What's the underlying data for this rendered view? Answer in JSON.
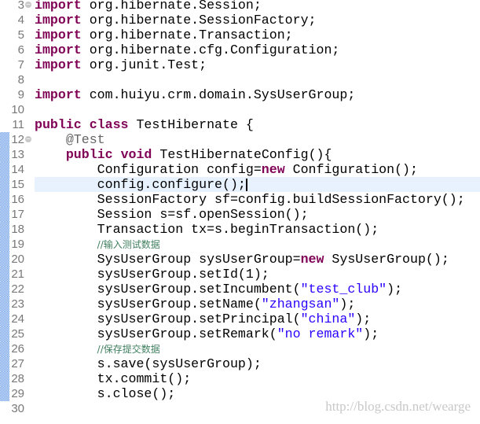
{
  "editor": {
    "lines": [
      {
        "n": "3",
        "fold": true,
        "changed": false,
        "segs": [
          [
            "k",
            "import"
          ],
          [
            "t",
            " org.hibernate.Session;"
          ]
        ]
      },
      {
        "n": "4",
        "segs": [
          [
            "k",
            "import"
          ],
          [
            "t",
            " org.hibernate.SessionFactory;"
          ]
        ]
      },
      {
        "n": "5",
        "segs": [
          [
            "k",
            "import"
          ],
          [
            "t",
            " org.hibernate.Transaction;"
          ]
        ]
      },
      {
        "n": "6",
        "segs": [
          [
            "k",
            "import"
          ],
          [
            "t",
            " org.hibernate.cfg.Configuration;"
          ]
        ]
      },
      {
        "n": "7",
        "segs": [
          [
            "k",
            "import"
          ],
          [
            "t",
            " org.junit.Test;"
          ]
        ]
      },
      {
        "n": "8",
        "segs": []
      },
      {
        "n": "9",
        "segs": [
          [
            "k",
            "import"
          ],
          [
            "t",
            " com.huiyu.crm.domain.SysUserGroup;"
          ]
        ]
      },
      {
        "n": "10",
        "segs": []
      },
      {
        "n": "11",
        "segs": [
          [
            "k",
            "public"
          ],
          [
            "t",
            " "
          ],
          [
            "k",
            "class"
          ],
          [
            "t",
            " TestHibernate {"
          ]
        ]
      },
      {
        "n": "12",
        "fold": true,
        "changed": true,
        "segs": [
          [
            "t",
            "    "
          ],
          [
            "a",
            "@Test"
          ]
        ]
      },
      {
        "n": "13",
        "changed": true,
        "segs": [
          [
            "t",
            "    "
          ],
          [
            "k",
            "public"
          ],
          [
            "t",
            " "
          ],
          [
            "k",
            "void"
          ],
          [
            "t",
            " TestHibernateConfig(){"
          ]
        ]
      },
      {
        "n": "14",
        "changed": true,
        "segs": [
          [
            "t",
            "        Configuration config="
          ],
          [
            "k",
            "new"
          ],
          [
            "t",
            " Configuration();"
          ]
        ]
      },
      {
        "n": "15",
        "changed": true,
        "current": true,
        "segs": [
          [
            "t",
            "        config.configure();"
          ]
        ]
      },
      {
        "n": "16",
        "changed": true,
        "segs": [
          [
            "t",
            "        SessionFactory sf=config.buildSessionFactory();"
          ]
        ]
      },
      {
        "n": "17",
        "changed": true,
        "segs": [
          [
            "t",
            "        Session s=sf.openSession();"
          ]
        ]
      },
      {
        "n": "18",
        "changed": true,
        "segs": [
          [
            "t",
            "        Transaction tx=s.beginTransaction();"
          ]
        ]
      },
      {
        "n": "19",
        "changed": true,
        "segs": [
          [
            "t",
            "        "
          ],
          [
            "c",
            "//输入测试数据"
          ]
        ]
      },
      {
        "n": "20",
        "changed": true,
        "segs": [
          [
            "t",
            "        SysUserGroup sysUserGroup="
          ],
          [
            "k",
            "new"
          ],
          [
            "t",
            " SysUserGroup();"
          ]
        ]
      },
      {
        "n": "21",
        "changed": true,
        "segs": [
          [
            "t",
            "        sysUserGroup.setId(1);"
          ]
        ]
      },
      {
        "n": "22",
        "changed": true,
        "segs": [
          [
            "t",
            "        sysUserGroup.setIncumbent("
          ],
          [
            "s",
            "\"test_club\""
          ],
          [
            "t",
            ");"
          ]
        ]
      },
      {
        "n": "23",
        "changed": true,
        "segs": [
          [
            "t",
            "        sysUserGroup.setName("
          ],
          [
            "s",
            "\"zhangsan\""
          ],
          [
            "t",
            ");"
          ]
        ]
      },
      {
        "n": "24",
        "changed": true,
        "segs": [
          [
            "t",
            "        sysUserGroup.setPrincipal("
          ],
          [
            "s",
            "\"china\""
          ],
          [
            "t",
            ");"
          ]
        ]
      },
      {
        "n": "25",
        "changed": true,
        "segs": [
          [
            "t",
            "        sysUserGroup.setRemark("
          ],
          [
            "s",
            "\"no remark\""
          ],
          [
            "t",
            ");"
          ]
        ]
      },
      {
        "n": "26",
        "changed": true,
        "segs": [
          [
            "t",
            "        "
          ],
          [
            "c",
            "//保存提交数据"
          ]
        ]
      },
      {
        "n": "27",
        "changed": true,
        "segs": [
          [
            "t",
            "        s.save(sysUserGroup);"
          ]
        ]
      },
      {
        "n": "28",
        "changed": true,
        "segs": [
          [
            "t",
            "        tx.commit();"
          ]
        ]
      },
      {
        "n": "29",
        "changed": true,
        "segs": [
          [
            "t",
            "        s.close();"
          ]
        ]
      },
      {
        "n": "30",
        "segs": []
      }
    ]
  },
  "watermark": "http://blog.csdn.net/wearge",
  "colors": {
    "keyword": "#7f0055",
    "string": "#2a00ff",
    "comment": "#3f7f5f",
    "annotation": "#646464",
    "current_line": "#e8f2fe"
  }
}
